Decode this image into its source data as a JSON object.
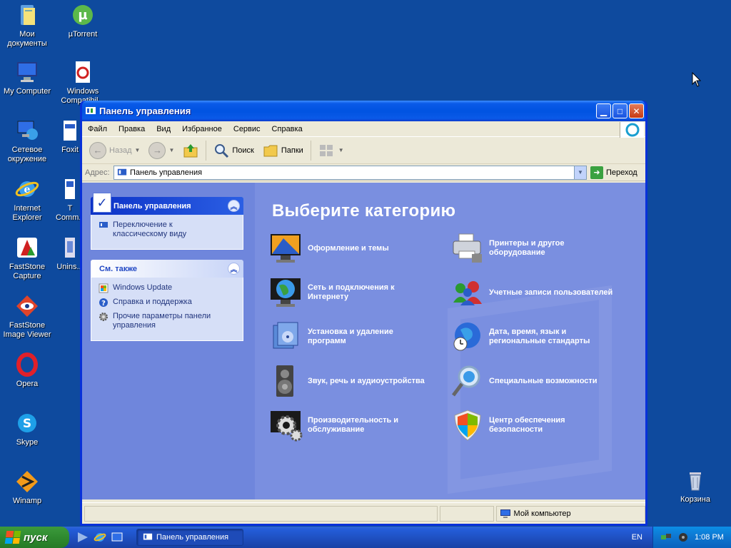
{
  "desktop": {
    "icons": [
      {
        "name": "my-documents",
        "label": "Мои\nдокументы",
        "icon": "folder-docs-icon"
      },
      {
        "name": "utorrent",
        "label": "µTorrent",
        "icon": "utorrent-icon"
      },
      {
        "name": "my-computer",
        "label": "My Computer",
        "icon": "computer-icon"
      },
      {
        "name": "windows-compat",
        "label": "Windows\nCompatibil...",
        "icon": "document-icon"
      },
      {
        "name": "network",
        "label": "Сетевое\nокружение",
        "icon": "network-icon"
      },
      {
        "name": "foxit",
        "label": "Foxit",
        "icon": "foxit-icon"
      },
      {
        "name": "internet-explorer",
        "label": "Internet\nExplorer",
        "icon": "ie-icon"
      },
      {
        "name": "tcommander",
        "label": "T\nComm...",
        "icon": "app-icon"
      },
      {
        "name": "faststone-capture",
        "label": "FastStone\nCapture",
        "icon": "faststone-capture-icon"
      },
      {
        "name": "uninstall",
        "label": "Unins...",
        "icon": "uninstall-icon"
      },
      {
        "name": "faststone-viewer",
        "label": "FastStone\nImage Viewer",
        "icon": "faststone-viewer-icon"
      },
      {
        "name": "opera",
        "label": "Opera",
        "icon": "opera-icon"
      },
      {
        "name": "skype",
        "label": "Skype",
        "icon": "skype-icon"
      },
      {
        "name": "winamp",
        "label": "Winamp",
        "icon": "winamp-icon"
      },
      {
        "name": "recycle-bin",
        "label": "Корзина",
        "icon": "recycle-bin-icon"
      }
    ]
  },
  "window": {
    "title": "Панель управления",
    "menu": [
      "Файл",
      "Правка",
      "Вид",
      "Избранное",
      "Сервис",
      "Справка"
    ],
    "toolbar": {
      "back": "Назад",
      "search": "Поиск",
      "folders": "Папки"
    },
    "address": {
      "label": "Адрес:",
      "value": "Панель управления",
      "go": "Переход"
    },
    "taskpane": {
      "panel_title": "Панель управления",
      "switch_link": "Переключение к\nклассическому виду",
      "see_also_title": "См. также",
      "see_also": [
        {
          "label": "Windows Update",
          "icon": "windows-update-icon"
        },
        {
          "label": "Справка и поддержка",
          "icon": "help-icon"
        },
        {
          "label": "Прочие параметры панели\nуправления",
          "icon": "gear-icon"
        }
      ]
    },
    "heading": "Выберите категорию",
    "categories": [
      {
        "label": "Оформление и темы",
        "icon": "appearance-icon"
      },
      {
        "label": "Принтеры и другое\nоборудование",
        "icon": "printer-icon"
      },
      {
        "label": "Сеть и подключения к\nИнтернету",
        "icon": "network-globe-icon"
      },
      {
        "label": "Учетные записи пользователей",
        "icon": "users-icon"
      },
      {
        "label": "Установка и удаление\nпрограмм",
        "icon": "install-icon"
      },
      {
        "label": "Дата, время, язык и\nрегиональные стандарты",
        "icon": "datetime-globe-icon"
      },
      {
        "label": "Звук, речь и аудиоустройства",
        "icon": "speaker-icon"
      },
      {
        "label": "Специальные возможности",
        "icon": "accessibility-icon"
      },
      {
        "label": "Производительность и\nобслуживание",
        "icon": "performance-icon"
      },
      {
        "label": "Центр обеспечения\nбезопасности",
        "icon": "security-shield-icon"
      }
    ],
    "status": {
      "location": "Мой компьютер"
    }
  },
  "taskbar": {
    "start": "пуск",
    "task": "Панель управления",
    "lang": "EN",
    "clock": "1:08 PM"
  },
  "colors": {
    "desktop": "#0e4a9e",
    "titlebar": "#0053e1",
    "category_pane": "#7a8fe0",
    "task_pane": "#6f86dc"
  }
}
